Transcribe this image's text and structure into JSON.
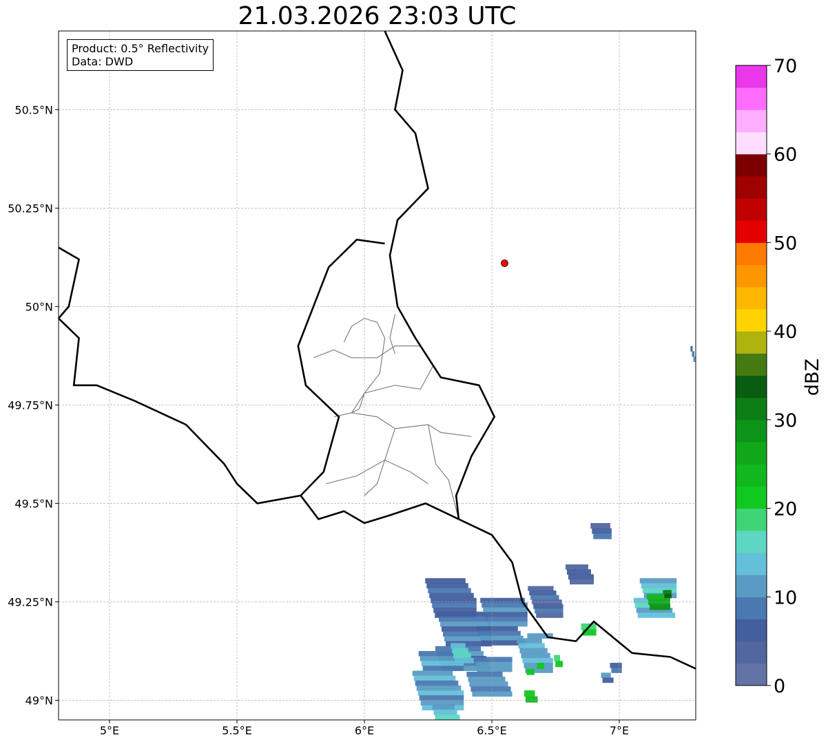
{
  "title": "21.03.2026 23:03 UTC",
  "annotation": {
    "product": "Product: 0.5° Reflectivity",
    "source": "Data: DWD"
  },
  "map": {
    "extent": {
      "lon_min": 4.8,
      "lon_max": 7.3,
      "lat_min": 48.95,
      "lat_max": 50.7
    },
    "lon_ticks": [
      {
        "value": 5.0,
        "label": "5°E"
      },
      {
        "value": 5.5,
        "label": "5.5°E"
      },
      {
        "value": 6.0,
        "label": "6°E"
      },
      {
        "value": 6.5,
        "label": "6.5°E"
      },
      {
        "value": 7.0,
        "label": "7°E"
      }
    ],
    "lat_ticks": [
      {
        "value": 50.5,
        "label": "50.5°N"
      },
      {
        "value": 50.25,
        "label": "50.25°N"
      },
      {
        "value": 50.0,
        "label": "50°N"
      },
      {
        "value": 49.75,
        "label": "49.75°N"
      },
      {
        "value": 49.5,
        "label": "49.5°N"
      },
      {
        "value": 49.25,
        "label": "49.25°N"
      },
      {
        "value": 49.0,
        "label": "49°N"
      }
    ],
    "gridlines": true,
    "marker": {
      "lon": 6.55,
      "lat": 50.11,
      "color": "#ff0000"
    },
    "borders": [
      [
        [
          6.08,
          50.7
        ],
        [
          6.15,
          50.6
        ],
        [
          6.12,
          50.5
        ],
        [
          6.2,
          50.44
        ],
        [
          6.25,
          50.3
        ],
        [
          6.13,
          50.22
        ],
        [
          6.1,
          50.13
        ],
        [
          6.13,
          50.0
        ],
        [
          6.2,
          49.92
        ],
        [
          6.3,
          49.82
        ],
        [
          6.45,
          49.8
        ],
        [
          6.51,
          49.72
        ],
        [
          6.42,
          49.62
        ],
        [
          6.36,
          49.52
        ],
        [
          6.37,
          49.46
        ]
      ],
      [
        [
          5.75,
          49.52
        ],
        [
          5.82,
          49.46
        ],
        [
          5.92,
          49.48
        ],
        [
          6.0,
          49.45
        ],
        [
          6.1,
          49.47
        ],
        [
          6.24,
          49.5
        ],
        [
          6.37,
          49.46
        ],
        [
          6.5,
          49.42
        ],
        [
          6.58,
          49.35
        ],
        [
          6.62,
          49.25
        ],
        [
          6.72,
          49.16
        ],
        [
          6.83,
          49.15
        ],
        [
          6.9,
          49.2
        ],
        [
          7.05,
          49.12
        ],
        [
          7.2,
          49.11
        ],
        [
          7.3,
          49.08
        ]
      ],
      [
        [
          6.08,
          50.16
        ],
        [
          5.97,
          50.17
        ],
        [
          5.86,
          50.1
        ],
        [
          5.8,
          50.0
        ],
        [
          5.74,
          49.9
        ],
        [
          5.77,
          49.8
        ],
        [
          5.9,
          49.72
        ],
        [
          5.84,
          49.58
        ],
        [
          5.75,
          49.52
        ]
      ],
      [
        [
          4.8,
          49.97
        ],
        [
          4.88,
          49.92
        ],
        [
          4.86,
          49.8
        ],
        [
          4.95,
          49.8
        ],
        [
          5.1,
          49.76
        ],
        [
          5.3,
          49.7
        ],
        [
          5.45,
          49.6
        ],
        [
          5.5,
          49.55
        ],
        [
          5.58,
          49.5
        ],
        [
          5.75,
          49.52
        ]
      ],
      [
        [
          4.8,
          50.15
        ],
        [
          4.88,
          50.12
        ],
        [
          4.84,
          50.0
        ],
        [
          4.8,
          49.97
        ]
      ]
    ],
    "inner_borders": [
      [
        [
          5.8,
          49.87
        ],
        [
          5.88,
          49.89
        ],
        [
          5.95,
          49.87
        ],
        [
          6.05,
          49.87
        ],
        [
          6.12,
          49.9
        ],
        [
          6.22,
          49.9
        ],
        [
          6.27,
          49.85
        ]
      ],
      [
        [
          5.92,
          49.91
        ],
        [
          5.95,
          49.95
        ],
        [
          6.0,
          49.97
        ],
        [
          6.05,
          49.96
        ],
        [
          6.08,
          49.92
        ],
        [
          6.06,
          49.83
        ],
        [
          6.0,
          49.78
        ],
        [
          5.95,
          49.73
        ]
      ],
      [
        [
          6.12,
          49.98
        ],
        [
          6.1,
          49.92
        ],
        [
          6.12,
          49.88
        ]
      ],
      [
        [
          5.95,
          49.73
        ],
        [
          6.05,
          49.72
        ],
        [
          6.12,
          49.69
        ],
        [
          6.25,
          49.7
        ],
        [
          6.3,
          49.68
        ],
        [
          6.42,
          49.67
        ]
      ],
      [
        [
          6.0,
          49.78
        ],
        [
          6.12,
          49.8
        ],
        [
          6.22,
          49.79
        ],
        [
          6.27,
          49.85
        ],
        [
          6.3,
          49.82
        ]
      ],
      [
        [
          6.12,
          49.69
        ],
        [
          6.08,
          49.61
        ],
        [
          6.05,
          49.55
        ],
        [
          6.0,
          49.52
        ]
      ],
      [
        [
          6.25,
          49.7
        ],
        [
          6.28,
          49.6
        ],
        [
          6.33,
          49.56
        ],
        [
          6.37,
          49.46
        ]
      ],
      [
        [
          5.85,
          49.55
        ],
        [
          5.97,
          49.57
        ],
        [
          6.08,
          49.61
        ],
        [
          6.18,
          49.58
        ],
        [
          6.25,
          49.55
        ]
      ],
      [
        [
          6.0,
          49.78
        ],
        [
          5.98,
          49.74
        ],
        [
          5.95,
          49.73
        ],
        [
          5.88,
          49.72
        ]
      ]
    ],
    "radar_cells": [
      {
        "lon": 6.35,
        "lat": 49.26,
        "w": 0.18,
        "h": 0.1,
        "dbz": 7
      },
      {
        "lon": 6.4,
        "lat": 49.15,
        "w": 0.2,
        "h": 0.15,
        "dbz": 9
      },
      {
        "lon": 6.55,
        "lat": 49.2,
        "w": 0.18,
        "h": 0.12,
        "dbz": 8
      },
      {
        "lon": 6.3,
        "lat": 49.05,
        "w": 0.18,
        "h": 0.15,
        "dbz": 11
      },
      {
        "lon": 6.5,
        "lat": 49.06,
        "w": 0.16,
        "h": 0.1,
        "dbz": 10
      },
      {
        "lon": 6.68,
        "lat": 49.12,
        "w": 0.12,
        "h": 0.1,
        "dbz": 12
      },
      {
        "lon": 6.72,
        "lat": 49.25,
        "w": 0.12,
        "h": 0.08,
        "dbz": 6
      },
      {
        "lon": 6.85,
        "lat": 49.32,
        "w": 0.1,
        "h": 0.05,
        "dbz": 5
      },
      {
        "lon": 6.93,
        "lat": 49.43,
        "w": 0.08,
        "h": 0.04,
        "dbz": 6
      },
      {
        "lon": 7.15,
        "lat": 49.26,
        "w": 0.15,
        "h": 0.1,
        "dbz": 14
      },
      {
        "lon": 6.98,
        "lat": 49.07,
        "w": 0.06,
        "h": 0.05,
        "dbz": 9
      },
      {
        "lon": 6.68,
        "lat": 49.08,
        "w": 0.05,
        "h": 0.03,
        "dbz": 22
      },
      {
        "lon": 6.78,
        "lat": 49.1,
        "w": 0.04,
        "h": 0.03,
        "dbz": 20
      },
      {
        "lon": 6.66,
        "lat": 49.01,
        "w": 0.05,
        "h": 0.03,
        "dbz": 24
      },
      {
        "lon": 6.88,
        "lat": 49.18,
        "w": 0.06,
        "h": 0.03,
        "dbz": 21
      },
      {
        "lon": 7.15,
        "lat": 49.25,
        "w": 0.1,
        "h": 0.04,
        "dbz": 26
      },
      {
        "lon": 7.18,
        "lat": 49.27,
        "w": 0.05,
        "h": 0.02,
        "dbz": 33
      },
      {
        "lon": 6.4,
        "lat": 49.12,
        "w": 0.08,
        "h": 0.05,
        "dbz": 15
      },
      {
        "lon": 6.33,
        "lat": 48.97,
        "w": 0.1,
        "h": 0.04,
        "dbz": 13
      },
      {
        "lon": 7.29,
        "lat": 49.88,
        "w": 0.01,
        "h": 0.04,
        "dbz": 8
      }
    ]
  },
  "colorbar": {
    "label": "dBZ",
    "min": 0,
    "max": 70,
    "tick_values": [
      0,
      10,
      20,
      30,
      40,
      50,
      60,
      70
    ],
    "tick_labels": [
      "0",
      "10",
      "20",
      "30",
      "40",
      "50",
      "60",
      "70"
    ],
    "colors": [
      "#6473a6",
      "#5266a0",
      "#435f9f",
      "#4a78b1",
      "#5a9bc4",
      "#64bfd9",
      "#5ed6c4",
      "#3ed575",
      "#10c81e",
      "#10b81c",
      "#10a81a",
      "#0c9418",
      "#0b7f15",
      "#095d10",
      "#457a11",
      "#aeb30d",
      "#fed300",
      "#fdb700",
      "#fd9700",
      "#fd7a00",
      "#e50000",
      "#c10000",
      "#9f0000",
      "#7d0000",
      "#ffddff",
      "#ffadff",
      "#ff6dff",
      "#ea37ea"
    ]
  }
}
